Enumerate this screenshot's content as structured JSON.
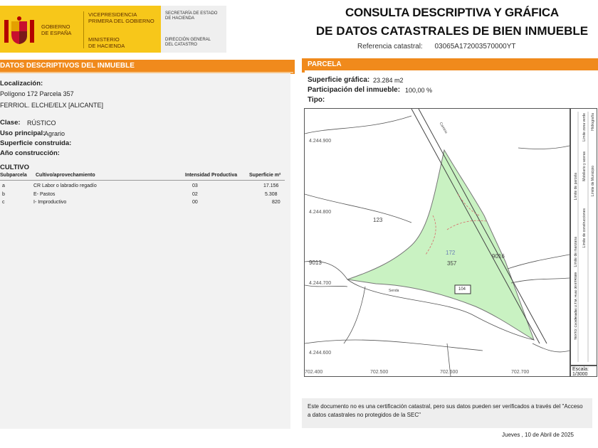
{
  "header": {
    "gov": [
      "GOBIERNO",
      "DE ESPAÑA"
    ],
    "vice": [
      "VICEPRESIDENCIA",
      "PRIMERA DEL GOBIERNO"
    ],
    "min": [
      "MINISTERIO",
      "DE HACIENDA"
    ],
    "sec": [
      "SECRETARÍA DE ESTADO",
      "DE HACIENDA"
    ],
    "dir": [
      "DIRECCIÓN GENERAL",
      "DEL CATASTRO"
    ],
    "title1": "CONSULTA DESCRIPTIVA Y GRÁFICA",
    "title2": "DE DATOS CATASTRALES DE BIEN INMUEBLE",
    "ref_label": "Referencia catastral:",
    "ref_value": "03065A172003570000YT"
  },
  "left": {
    "bar": "DATOS DESCRIPTIVOS DEL INMUEBLE",
    "loc_label": "Localización:",
    "loc_line1": "Polígono 172 Parcela 357",
    "loc_line2": "FERRIOL. ELCHE/ELX [ALICANTE]",
    "clase_label": "Clase:",
    "clase_value": "RÚSTICO",
    "uso_label": "Uso principal:",
    "uso_value": "Agrario",
    "sup_label": "Superficie construida:",
    "anio_label": "Año construcción:",
    "cultivo_label": "CULTIVO",
    "table": {
      "headers": [
        "Subparcela",
        "Cultivo/aprovechamiento",
        "Intensidad Productiva",
        "Superficie m²"
      ],
      "rows": [
        [
          "a",
          "CR Labor o labradío regadío",
          "03",
          "17.156"
        ],
        [
          "b",
          "E- Pastos",
          "02",
          "5.308"
        ],
        [
          "c",
          "I- Improductivo",
          "00",
          "820"
        ]
      ]
    }
  },
  "right": {
    "bar": "PARCELA",
    "sup_label": "Superficie gráfica:",
    "sup_value": "23.284 m2",
    "part_label": "Participación del inmueble:",
    "part_value": "100,00 %",
    "tipo_label": "Tipo:",
    "map": {
      "y_ticks": [
        "4.244.900",
        "4.244.800",
        "4.244.700",
        "4.244.600"
      ],
      "x_ticks": [
        "702.400",
        "702.500",
        "702.600",
        "702.700"
      ],
      "labels": {
        "p123": "123",
        "p172": "172",
        "p357": "357",
        "p9013": "9013",
        "p9016": "9016",
        "p104": "104",
        "road1": "Camino",
        "road2": "Senda"
      },
      "parcel_color": "#c9f2c2"
    },
    "legend": [
      "Límite de manzana",
      "Límite de parcela",
      "Límite de construcciones",
      "Mobiliario y aceras",
      "Límite zona verde",
      "Hidrografía",
      "Límite de Municipio"
    ],
    "legend_side": "TEXTO: Coordenadas U.T.M. Huso 30 ETRS89",
    "scale_label": "Escala:",
    "scale_value": "1/3000"
  },
  "notice": "Este documento no es una certificación catastral, pero sus datos pueden ser verificados a través del \"Acceso a datos catastrales no protegidos de la SEC\"",
  "date": "Jueves , 10 de Abril de 2025",
  "colors": {
    "accent": "#f08a1c",
    "brand_yellow": "#f7c71a"
  }
}
